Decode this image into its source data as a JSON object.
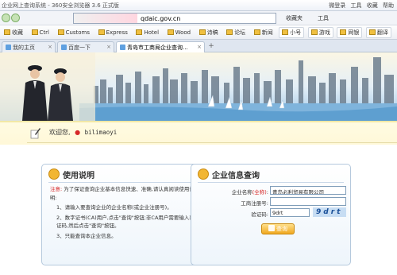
{
  "browser": {
    "window_title": "企业网上查询系统 - 360安全浏览器 3.6 正式版",
    "title_right": [
      "微登录",
      "工具",
      "收藏",
      "帮助"
    ],
    "url": "qdaic.gov.cn",
    "favorites": [
      "收藏",
      "Ctrl",
      "Customs",
      "Express",
      "Hotel",
      "Wood",
      "诗稿",
      "论坛",
      "新闻",
      "小号",
      "游戏",
      "网银",
      "翻译"
    ],
    "address_labels": [
      "收藏夹",
      "工具"
    ],
    "tabs": [
      {
        "label": "我的主页"
      },
      {
        "label": "百度一下"
      },
      {
        "label": "青岛市工商局企业查询..."
      }
    ]
  },
  "welcome": {
    "greeting": "欢迎您,",
    "username": "bilimaoyi"
  },
  "instructions_panel": {
    "title": "使用说明",
    "note_label": "注意:",
    "note_text": "为了保证查询企业基本信息快速、准确,请认真阅读使用说明:",
    "items": [
      "1、请输入要查询企业的企业名称(或企业注册号)。",
      "2、数字证书(CA)用户,点击\"查询\"按钮;非CA用户需要输入验证码,然后点击\"查询\"按钮。",
      "3、只能查询本企业信息。"
    ]
  },
  "query_panel": {
    "title": "企业信息查询",
    "fields": {
      "company_name": {
        "label": "企业名称",
        "hint": "(全称)",
        "value": "青岛必利贸易有限公司"
      },
      "reg_no": {
        "label": "工商注册号",
        "value": ""
      },
      "captcha": {
        "label": "验证码",
        "value": "9drt",
        "image_text": "9drt"
      }
    },
    "submit_label": "查询"
  }
}
